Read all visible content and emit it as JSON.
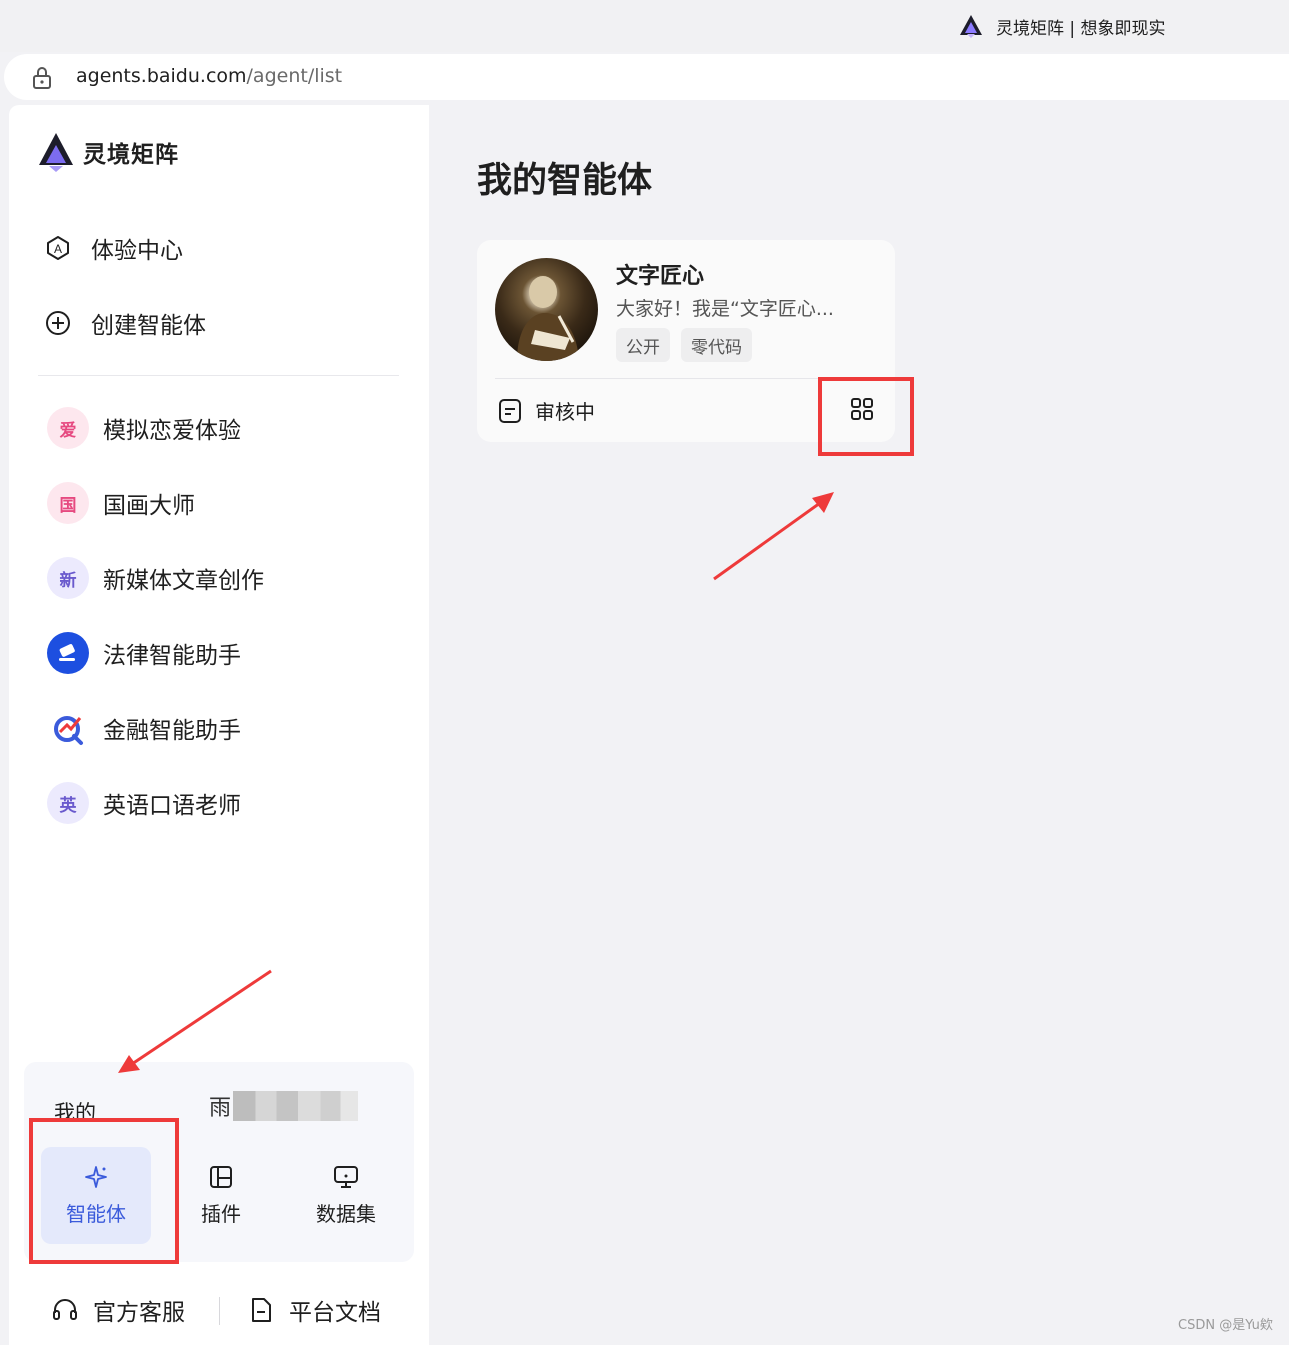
{
  "browser": {
    "tab_title": "灵境矩阵 | 想象即现实",
    "url_host": "agents.baidu.com",
    "url_path": "/agent/list"
  },
  "sidebar": {
    "brand": "灵境矩阵",
    "nav": [
      {
        "label": "体验中心",
        "icon": "a-circle-icon"
      },
      {
        "label": "创建智能体",
        "icon": "plus-circle-icon"
      }
    ],
    "agents": [
      {
        "label": "模拟恋爱体验",
        "avatar": "爱",
        "bg": "#fde7ee",
        "fg": "#e64980"
      },
      {
        "label": "国画大师",
        "avatar": "国",
        "bg": "#fde7ee",
        "fg": "#e64980"
      },
      {
        "label": "新媒体文章创作",
        "avatar": "新",
        "bg": "#eceafd",
        "fg": "#6a5acd"
      },
      {
        "label": "法律智能助手",
        "avatar": "",
        "bg": "#1d4fe0",
        "fg": "#ffffff"
      },
      {
        "label": "金融智能助手",
        "avatar": "",
        "bg": "#ffffff",
        "fg": "#3b5bdb"
      },
      {
        "label": "英语口语老师",
        "avatar": "英",
        "bg": "#eceafd",
        "fg": "#6a5acd"
      }
    ],
    "mine": {
      "label": "我的",
      "user_initial": "雨",
      "tabs": [
        {
          "label": "智能体",
          "icon": "sparkle-icon",
          "active": true
        },
        {
          "label": "插件",
          "icon": "layout-icon",
          "active": false
        },
        {
          "label": "数据集",
          "icon": "monitor-icon",
          "active": false
        }
      ]
    },
    "footer": [
      {
        "label": "官方客服",
        "icon": "headset-icon"
      },
      {
        "label": "平台文档",
        "icon": "document-icon"
      }
    ]
  },
  "main": {
    "title": "我的智能体",
    "card": {
      "name": "文字匠心",
      "desc": "大家好！我是“文字匠心...",
      "tags": [
        "公开",
        "零代码"
      ],
      "status": "审核中"
    }
  },
  "watermark": "CSDN @是Yu欸",
  "colors": {
    "accent": "#3b5bdb",
    "highlight": "#ee3a3a"
  }
}
